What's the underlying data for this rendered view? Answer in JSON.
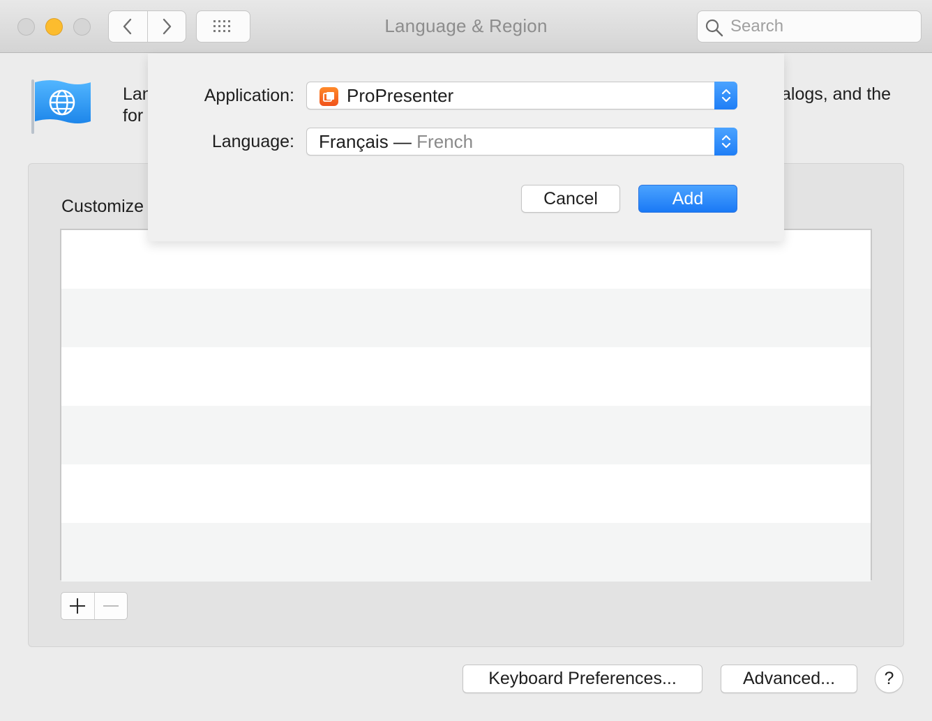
{
  "window": {
    "title": "Language & Region",
    "search_placeholder": "Search"
  },
  "header": {
    "text_left": "Lan for",
    "text_right": "alogs, and the"
  },
  "panel": {
    "customize_label": "Customize",
    "table_rows": 6,
    "add_symbol": "+",
    "remove_symbol": "—"
  },
  "footer": {
    "keyboard_button": "Keyboard Preferences...",
    "advanced_button": "Advanced...",
    "help_button": "?"
  },
  "sheet": {
    "application_label": "Application:",
    "application_value": "ProPresenter",
    "language_label": "Language:",
    "language_value": "Français",
    "language_separator": " — ",
    "language_subvalue": "French",
    "cancel_label": "Cancel",
    "add_label": "Add"
  },
  "colors": {
    "accent": "#1f7ef6",
    "minimize": "#fcbc2e",
    "app_icon": "#f0521b"
  },
  "icons": [
    "chevron-left-icon",
    "chevron-right-icon",
    "grid-icon",
    "search-icon",
    "flag-globe-icon",
    "propresenter-app-icon",
    "up-down-arrows-icon"
  ]
}
